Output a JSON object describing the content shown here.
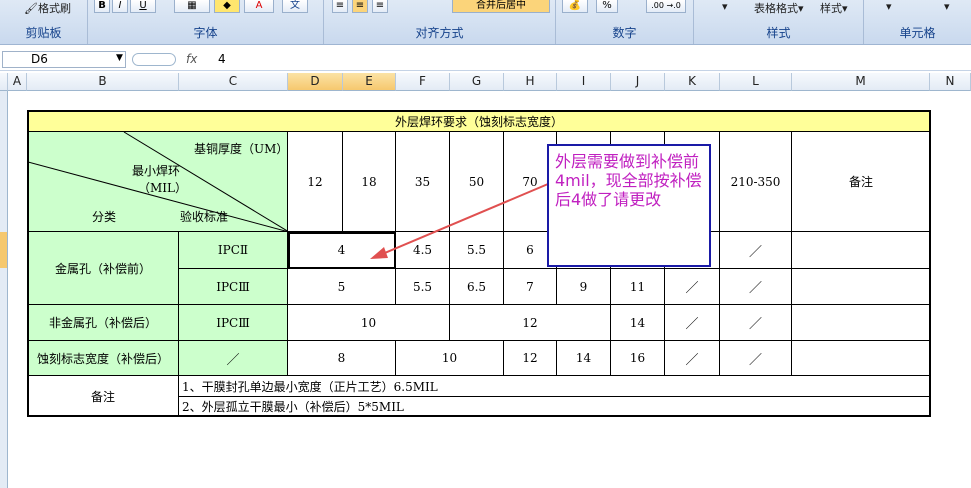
{
  "ribbon": {
    "groups": [
      {
        "label": "剪贴板"
      },
      {
        "label": "字体"
      },
      {
        "label": "对齐方式"
      },
      {
        "label": "数字"
      },
      {
        "label": "样式"
      },
      {
        "label": "单元格"
      }
    ],
    "clipboard_top": "格式刷",
    "font_bold": "B",
    "font_italic": "I",
    "font_underline": "U",
    "font_color_a": "A",
    "font_wen": "文",
    "merge_center": "合并后居中",
    "percent": "%",
    "decimal": ".00 →.0",
    "table_format": "表格格式",
    "cell_style": "样式"
  },
  "formula_bar": {
    "name_box": "D6",
    "fx": "fx",
    "value": "4"
  },
  "columns": [
    "A",
    "B",
    "C",
    "D",
    "E",
    "F",
    "G",
    "H",
    "I",
    "J",
    "K",
    "L",
    "M",
    "N"
  ],
  "table": {
    "title": "外层焊环要求（蚀刻标志宽度）",
    "header": {
      "diag_top_right": "基铜厚度（UM）",
      "diag_middle1": "最小焊环",
      "diag_middle2": "（MIL）",
      "diag_bottom_left": "分类",
      "diag_bottom_right": "验收标准",
      "thickness": [
        "12",
        "18",
        "35",
        "50",
        "70",
        "",
        "",
        "",
        "210-350"
      ],
      "remark": "备注"
    },
    "rows": {
      "plated_before": "金属孔（补偿前）",
      "ipc2": "IPCⅡ",
      "ipc3": "IPCⅢ",
      "nonplated": "非金属孔（补偿后）",
      "etch": "蚀刻标志宽度（补偿后）",
      "slash": "／",
      "remark": "备注"
    },
    "values": {
      "r1_d": "4",
      "r1_f": "4.5",
      "r1_g": "5.5",
      "r1_h": "6",
      "r1_l": "／",
      "r2_d": "5",
      "r2_f": "5.5",
      "r2_g": "6.5",
      "r2_h": "7",
      "r2_i": "9",
      "r2_j": "11",
      "r2_k": "／",
      "r2_l": "／",
      "r3_d": "10",
      "r3_g": "12",
      "r3_j": "14",
      "r3_k": "／",
      "r3_l": "／",
      "r4_c": "／",
      "r4_d": "8",
      "r4_f": "10",
      "r4_h": "12",
      "r4_i": "14",
      "r4_j": "16",
      "r4_k": "／",
      "r4_l": "／"
    },
    "notes": [
      "1、干膜封孔单边最小宽度（正片工艺）6.5MIL",
      "2、外层孤立干膜最小（补偿后）5*5MIL"
    ]
  },
  "callout": {
    "text": "外层需要做到补偿前4mil，现全部按补偿后4做了请更改",
    "text_color": "#c020c0",
    "border_color": "#1a1aa6"
  },
  "colors": {
    "header_green": "#ccffcc",
    "title_yellow": "#ffff99",
    "arrow_red": "#e05050"
  }
}
